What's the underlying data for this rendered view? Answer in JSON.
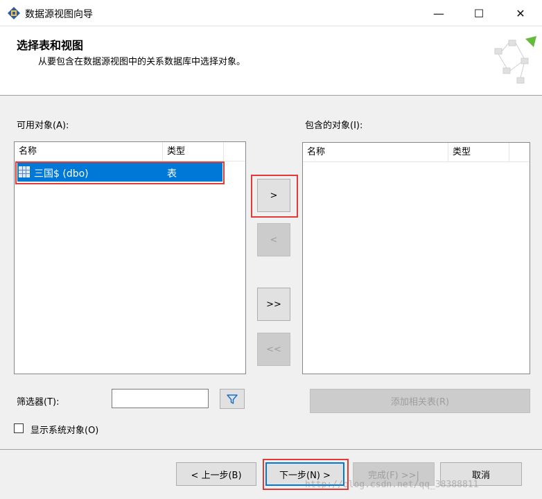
{
  "window": {
    "title": "数据源视图向导",
    "minimize": "—",
    "maximize": "☐",
    "close": "✕"
  },
  "header": {
    "title": "选择表和视图",
    "subtitle": "从要包含在数据源视图中的关系数据库中选择对象。"
  },
  "available": {
    "label": "可用对象(A):",
    "columns": [
      "名称",
      "类型"
    ],
    "rows": [
      {
        "name": "三国$ (dbo)",
        "type": "表",
        "selected": true
      }
    ]
  },
  "included": {
    "label": "包含的对象(I):",
    "columns": [
      "名称",
      "类型"
    ],
    "rows": []
  },
  "transfer_buttons": {
    "add": ">",
    "remove": "<",
    "add_all": ">>",
    "remove_all": "<<"
  },
  "filter": {
    "label": "筛选器(T):",
    "value": "",
    "icon": "filter-icon"
  },
  "add_related": "添加相关表(R)",
  "show_system": {
    "label": "显示系统对象(O)",
    "checked": false
  },
  "footer": {
    "back": "< 上一步(B)",
    "next": "下一步(N) >",
    "finish": "完成(F) >>|",
    "cancel": "取消"
  },
  "watermark": "http://blog.csdn.net/qq_38388811"
}
